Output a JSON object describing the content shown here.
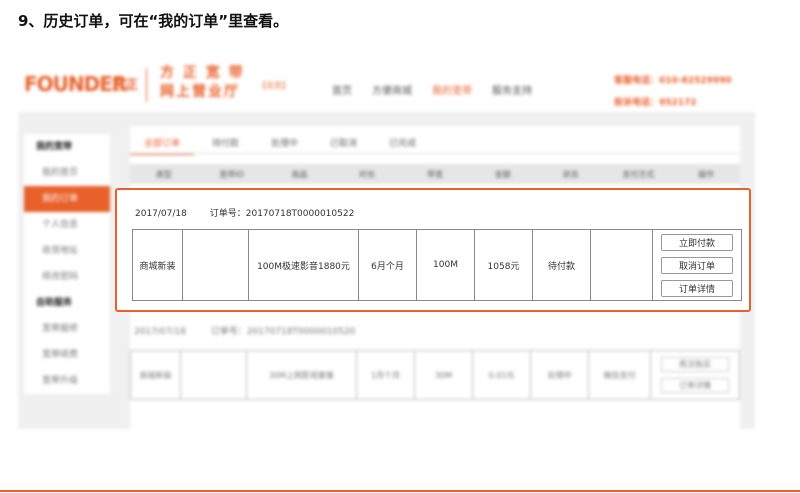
{
  "heading": "9、历史订单，可在“我的订单”里查看。",
  "header": {
    "logo": "FOUNDER",
    "logo_cn": "方正",
    "brand_line1": "方 正 宽 带",
    "brand_line2": "网上营业厅",
    "city": "【北京】",
    "nav": [
      "首页",
      "方便商城",
      "我的宽带",
      "服务支持"
    ],
    "contact": [
      "客服电话：010-82529990",
      "投诉电话：952172"
    ]
  },
  "sidebar": {
    "items": [
      {
        "label": "我的宽带",
        "type": "group"
      },
      {
        "label": "我的首页",
        "type": "item"
      },
      {
        "label": "我的订单",
        "type": "active"
      },
      {
        "label": "个人信息",
        "type": "item"
      },
      {
        "label": "收货地址",
        "type": "item"
      },
      {
        "label": "修改密码",
        "type": "item"
      },
      {
        "label": "自助服务",
        "type": "group"
      },
      {
        "label": "宽带报修",
        "type": "item"
      },
      {
        "label": "宽带续费",
        "type": "item"
      },
      {
        "label": "宽带升级",
        "type": "item"
      }
    ]
  },
  "tabs": [
    "全部订单",
    "待付款",
    "处理中",
    "已取消",
    "已完成"
  ],
  "table_headers": [
    "类型",
    "宽带ID",
    "商品",
    "时长",
    "带宽",
    "金额",
    "状态",
    "支付方式",
    "操作"
  ],
  "order1": {
    "date": "2017/07/18",
    "order_no": "订单号：20170718T0000010522",
    "type": "商城新装",
    "product": "100M极速影音1880元",
    "duration": "6月个月",
    "bandwidth": "100M",
    "amount": "1058元",
    "status": "待付款",
    "actions": [
      "立即付款",
      "取消订单",
      "订单详情"
    ]
  },
  "order2": {
    "date": "2017/07/18",
    "order_no": "订单号：20170718T0000010520",
    "type": "商城新装",
    "product": "30M上网影视套餐",
    "duration": "1月个月",
    "bandwidth": "30M",
    "amount": "0.01元",
    "status": "处理中",
    "payment": "微信支付",
    "actions": [
      "再次购买",
      "订单详情"
    ]
  }
}
